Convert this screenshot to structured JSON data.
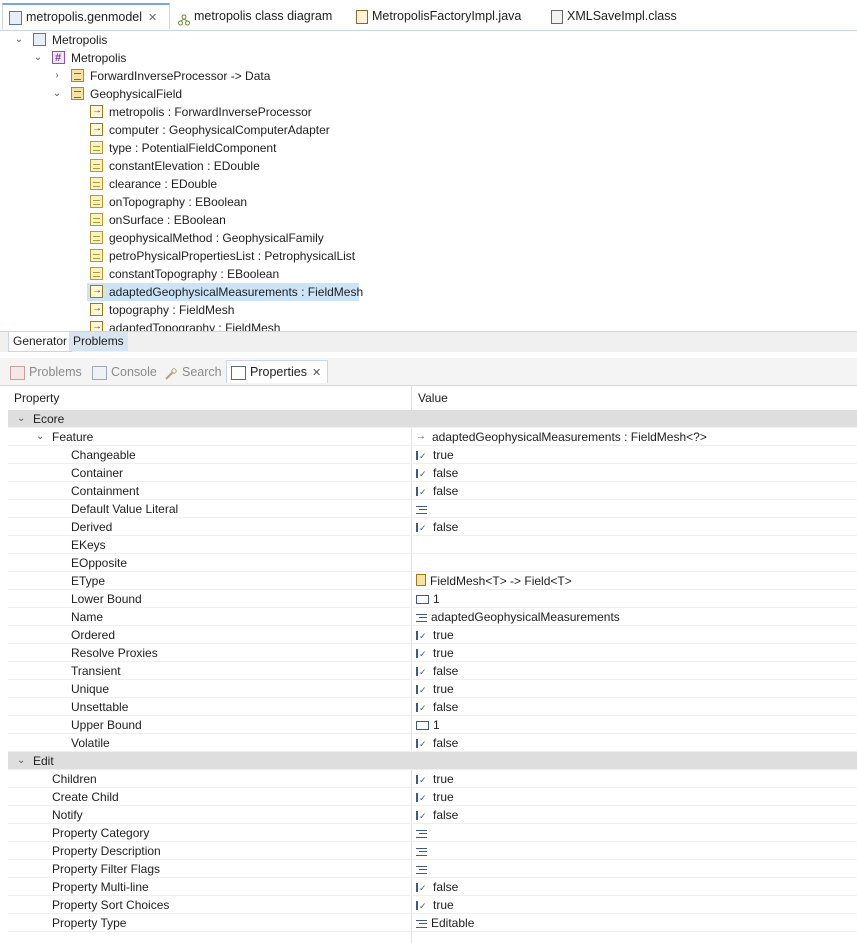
{
  "editor_tabs": [
    {
      "label": "metropolis.genmodel",
      "active": true,
      "icon": "genmodel-icon",
      "closable": true
    },
    {
      "label": "metropolis class diagram",
      "active": false,
      "icon": "class-diagram-icon"
    },
    {
      "label": "MetropolisFactoryImpl.java",
      "active": false,
      "icon": "java-file-icon"
    },
    {
      "label": "XMLSaveImpl.class",
      "active": false,
      "icon": "class-file-icon"
    }
  ],
  "tree": [
    {
      "label": "Metropolis",
      "level": 0,
      "expanded": true,
      "icon": "model"
    },
    {
      "label": "Metropolis",
      "level": 1,
      "expanded": true,
      "icon": "pkg"
    },
    {
      "label": "ForwardInverseProcessor -> Data",
      "level": 2,
      "expanded": false,
      "icon": "cls"
    },
    {
      "label": "GeophysicalField",
      "level": 2,
      "expanded": true,
      "icon": "cls"
    },
    {
      "label": "metropolis : ForwardInverseProcessor",
      "level": 3,
      "icon": "ref"
    },
    {
      "label": "computer : GeophysicalComputerAdapter",
      "level": 3,
      "icon": "ref"
    },
    {
      "label": "type : PotentialFieldComponent",
      "level": 3,
      "icon": "attr"
    },
    {
      "label": "constantElevation : EDouble",
      "level": 3,
      "icon": "attr"
    },
    {
      "label": "clearance : EDouble",
      "level": 3,
      "icon": "attr"
    },
    {
      "label": "onTopography : EBoolean",
      "level": 3,
      "icon": "attr"
    },
    {
      "label": "onSurface : EBoolean",
      "level": 3,
      "icon": "attr"
    },
    {
      "label": "geophysicalMethod : GeophysicalFamily",
      "level": 3,
      "icon": "attr"
    },
    {
      "label": "petroPhysicalPropertiesList : PetrophysicalList",
      "level": 3,
      "icon": "attr"
    },
    {
      "label": "constantTopography : EBoolean",
      "level": 3,
      "icon": "attr"
    },
    {
      "label": "adaptedGeophysicalMeasurements : FieldMesh",
      "level": 3,
      "icon": "ref",
      "selected": true
    },
    {
      "label": "topography : FieldMesh",
      "level": 3,
      "icon": "ref"
    },
    {
      "label": "adaptedTopography : FieldMesh",
      "level": 3,
      "icon": "ref"
    }
  ],
  "editor_bottom_tabs": [
    {
      "label": "Generator",
      "active": true
    },
    {
      "label": "Problems",
      "active": false
    }
  ],
  "view_tabs": [
    {
      "label": "Problems",
      "active": false,
      "icon": "problems-icon"
    },
    {
      "label": "Console",
      "active": false,
      "icon": "console-icon"
    },
    {
      "label": "Search",
      "active": false,
      "icon": "search-icon"
    },
    {
      "label": "Properties",
      "active": true,
      "icon": "properties-icon",
      "closable": true
    }
  ],
  "properties": {
    "col_property": "Property",
    "col_value": "Value",
    "rows": [
      {
        "type": "cat",
        "name": "Ecore",
        "indent": 0
      },
      {
        "type": "sub",
        "name": "Feature",
        "indent": 1,
        "value": "adaptedGeophysicalMeasurements : FieldMesh<?>",
        "icon": "ref"
      },
      {
        "type": "prop",
        "name": "Changeable",
        "value": "true",
        "icon": "bool"
      },
      {
        "type": "prop",
        "name": "Container",
        "value": "false",
        "icon": "bool"
      },
      {
        "type": "prop",
        "name": "Containment",
        "value": "false",
        "icon": "bool"
      },
      {
        "type": "prop",
        "name": "Default Value Literal",
        "value": "",
        "icon": "str"
      },
      {
        "type": "prop",
        "name": "Derived",
        "value": "false",
        "icon": "bool"
      },
      {
        "type": "prop",
        "name": "EKeys",
        "value": "",
        "icon": ""
      },
      {
        "type": "prop",
        "name": "EOpposite",
        "value": "",
        "icon": ""
      },
      {
        "type": "prop",
        "name": "EType",
        "value": "FieldMesh<T> -> Field<T>",
        "icon": "cls"
      },
      {
        "type": "prop",
        "name": "Lower Bound",
        "value": "1",
        "icon": "num"
      },
      {
        "type": "prop",
        "name": "Name",
        "value": "adaptedGeophysicalMeasurements",
        "icon": "str"
      },
      {
        "type": "prop",
        "name": "Ordered",
        "value": "true",
        "icon": "bool"
      },
      {
        "type": "prop",
        "name": "Resolve Proxies",
        "value": "true",
        "icon": "bool"
      },
      {
        "type": "prop",
        "name": "Transient",
        "value": "false",
        "icon": "bool"
      },
      {
        "type": "prop",
        "name": "Unique",
        "value": "true",
        "icon": "bool"
      },
      {
        "type": "prop",
        "name": "Unsettable",
        "value": "false",
        "icon": "bool"
      },
      {
        "type": "prop",
        "name": "Upper Bound",
        "value": "1",
        "icon": "num"
      },
      {
        "type": "prop",
        "name": "Volatile",
        "value": "false",
        "icon": "bool"
      },
      {
        "type": "cat2",
        "name": "Edit",
        "indent": 0
      },
      {
        "type": "prop1",
        "name": "Children",
        "value": "true",
        "icon": "bool"
      },
      {
        "type": "prop1",
        "name": "Create Child",
        "value": "true",
        "icon": "bool"
      },
      {
        "type": "prop1",
        "name": "Notify",
        "value": "false",
        "icon": "bool"
      },
      {
        "type": "prop1",
        "name": "Property Category",
        "value": "",
        "icon": "str"
      },
      {
        "type": "prop1",
        "name": "Property Description",
        "value": "",
        "icon": "str"
      },
      {
        "type": "prop1",
        "name": "Property Filter Flags",
        "value": "",
        "icon": "str"
      },
      {
        "type": "prop1",
        "name": "Property Multi-line",
        "value": "false",
        "icon": "bool"
      },
      {
        "type": "prop1",
        "name": "Property Sort Choices",
        "value": "true",
        "icon": "bool"
      },
      {
        "type": "prop1",
        "name": "Property Type",
        "value": "Editable",
        "icon": "str"
      }
    ]
  }
}
